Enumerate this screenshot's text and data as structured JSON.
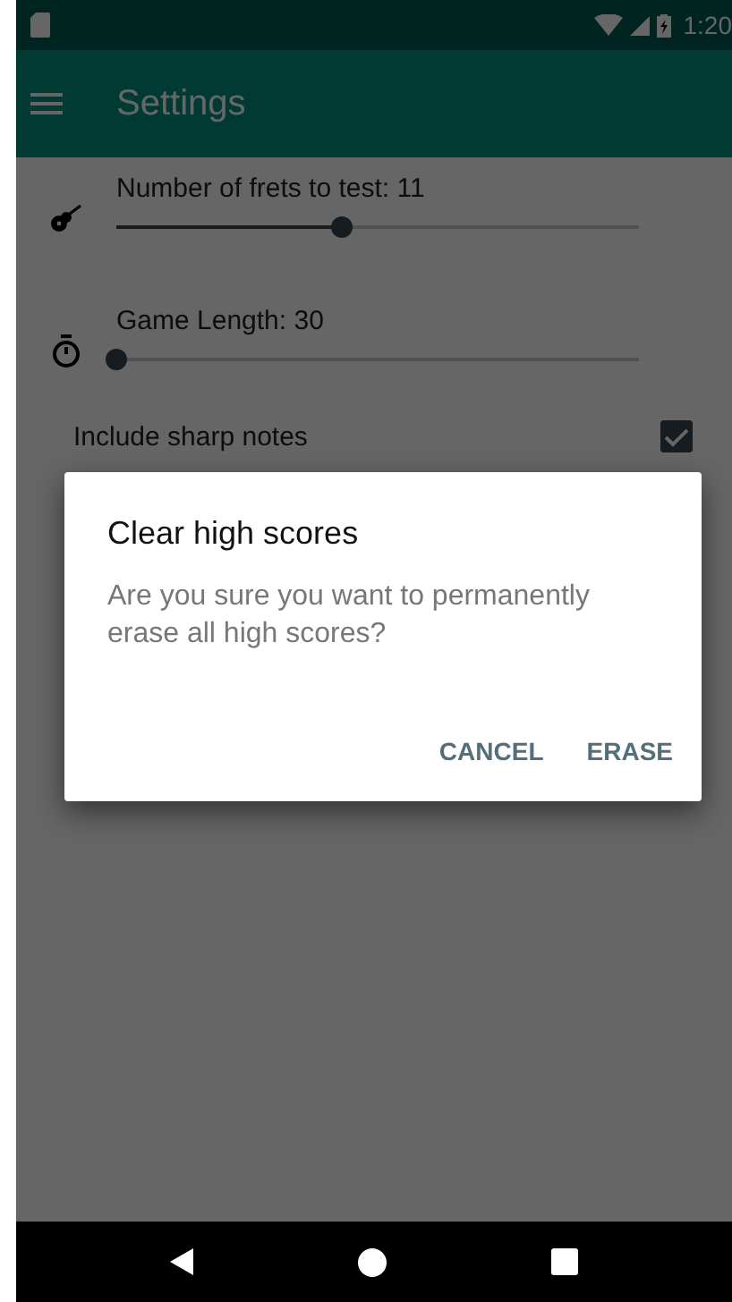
{
  "status_bar": {
    "time": "1:20"
  },
  "app_bar": {
    "title": "Settings"
  },
  "settings": [
    {
      "kind": "slider",
      "label": "Number of frets to test: 11",
      "level": 0.43
    },
    {
      "kind": "slider",
      "label": "Game Length: 30",
      "level": 0
    },
    {
      "kind": "checkbox",
      "label": "Include sharp notes",
      "checked": true
    }
  ],
  "dialog": {
    "title": "Clear high scores",
    "message": "Are you sure you want to permanently erase all high scores?",
    "buttons": [
      "CANCEL",
      "ERASE"
    ]
  }
}
